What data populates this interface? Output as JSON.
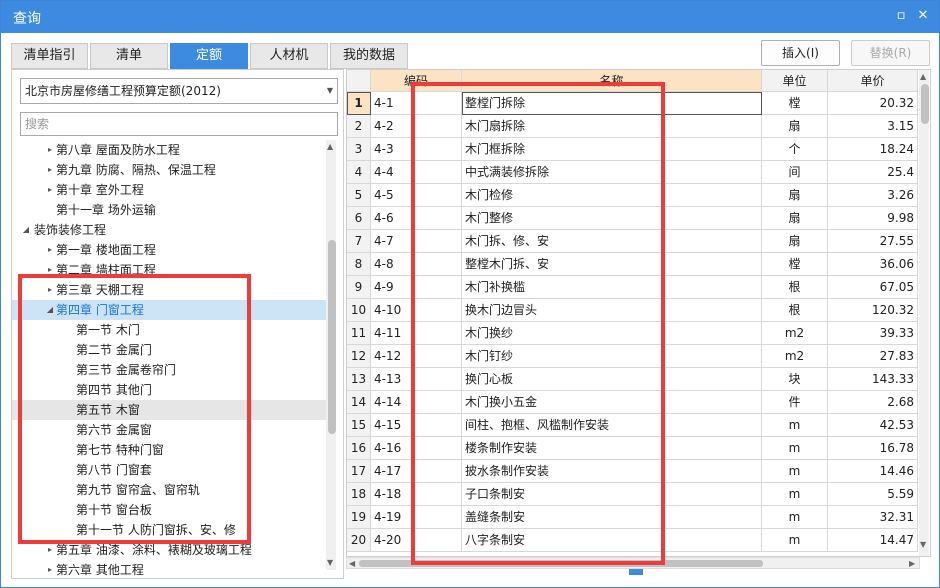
{
  "window": {
    "title": "查询",
    "restore_label": "▫",
    "close_label": "✕"
  },
  "tabs": [
    "清单指引",
    "清单",
    "定额",
    "人材机",
    "我的数据"
  ],
  "actions": {
    "insert_label": "插入(I)",
    "replace_label": "替换(R)"
  },
  "left": {
    "quota_select": "北京市房屋修缮工程预算定额(2012)",
    "search_placeholder": "搜索",
    "tree": [
      {
        "label": "第八章 屋面及防水工程",
        "level": 1,
        "toggle": "▸"
      },
      {
        "label": "第九章 防腐、隔热、保温工程",
        "level": 1,
        "toggle": "▸"
      },
      {
        "label": "第十章 室外工程",
        "level": 1,
        "toggle": "▸"
      },
      {
        "label": "第十一章 场外运输",
        "level": 1,
        "toggle": ""
      },
      {
        "label": "装饰装修工程",
        "level": 0,
        "toggle": "◢"
      },
      {
        "label": "第一章 楼地面工程",
        "level": 1,
        "toggle": "▸"
      },
      {
        "label": "第二章 墙柱面工程",
        "level": 1,
        "toggle": "▸"
      },
      {
        "label": "第三章 天棚工程",
        "level": 1,
        "toggle": "▸"
      },
      {
        "label": "第四章 门窗工程",
        "level": 1,
        "toggle": "◢",
        "state": "selected"
      },
      {
        "label": "第一节 木门",
        "level": 2,
        "toggle": ""
      },
      {
        "label": "第二节 金属门",
        "level": 2,
        "toggle": ""
      },
      {
        "label": "第三节 金属卷帘门",
        "level": 2,
        "toggle": ""
      },
      {
        "label": "第四节 其他门",
        "level": 2,
        "toggle": ""
      },
      {
        "label": "第五节 木窗",
        "level": 2,
        "toggle": "",
        "state": "hover"
      },
      {
        "label": "第六节 金属窗",
        "level": 2,
        "toggle": ""
      },
      {
        "label": "第七节 特种门窗",
        "level": 2,
        "toggle": ""
      },
      {
        "label": "第八节 门窗套",
        "level": 2,
        "toggle": ""
      },
      {
        "label": "第九节 窗帘盒、窗帘轨",
        "level": 2,
        "toggle": ""
      },
      {
        "label": "第十节 窗台板",
        "level": 2,
        "toggle": ""
      },
      {
        "label": "第十一节 人防门窗拆、安、修",
        "level": 2,
        "toggle": ""
      },
      {
        "label": "第五章 油漆、涂料、裱糊及玻璃工程",
        "level": 1,
        "toggle": "▸"
      },
      {
        "label": "第六章 其他工程",
        "level": 1,
        "toggle": "▸"
      }
    ]
  },
  "grid": {
    "headers": [
      "",
      "编码",
      "名称",
      "单位",
      "单价"
    ],
    "rows": [
      [
        "1",
        "4-1",
        "整樘门拆除",
        "樘",
        "20.32"
      ],
      [
        "2",
        "4-2",
        "木门扇拆除",
        "扇",
        "3.15"
      ],
      [
        "3",
        "4-3",
        "木门框拆除",
        "个",
        "18.24"
      ],
      [
        "4",
        "4-4",
        "中式满装修拆除",
        "间",
        "25.4"
      ],
      [
        "5",
        "4-5",
        "木门检修",
        "扇",
        "3.26"
      ],
      [
        "6",
        "4-6",
        "木门整修",
        "扇",
        "9.98"
      ],
      [
        "7",
        "4-7",
        "木门拆、修、安",
        "扇",
        "27.55"
      ],
      [
        "8",
        "4-8",
        "整樘木门拆、安",
        "樘",
        "36.06"
      ],
      [
        "9",
        "4-9",
        "木门补换槛",
        "根",
        "67.05"
      ],
      [
        "10",
        "4-10",
        "换木门边冒头",
        "根",
        "120.32"
      ],
      [
        "11",
        "4-11",
        "木门换纱",
        "m2",
        "39.33"
      ],
      [
        "12",
        "4-12",
        "木门钉纱",
        "m2",
        "27.83"
      ],
      [
        "13",
        "4-13",
        "换门心板",
        "块",
        "143.33"
      ],
      [
        "14",
        "4-14",
        "木门换小五金",
        "件",
        "2.68"
      ],
      [
        "15",
        "4-15",
        "间柱、抱框、风槛制作安装",
        "m",
        "42.53"
      ],
      [
        "16",
        "4-16",
        "楼条制作安装",
        "m",
        "16.78"
      ],
      [
        "17",
        "4-17",
        "披水条制作安装",
        "m",
        "14.46"
      ],
      [
        "18",
        "4-18",
        "子口条制安",
        "m",
        "5.59"
      ],
      [
        "19",
        "4-19",
        "盖缝条制安",
        "m",
        "32.31"
      ],
      [
        "20",
        "4-20",
        "八字条制安",
        "m",
        "14.47"
      ]
    ]
  }
}
